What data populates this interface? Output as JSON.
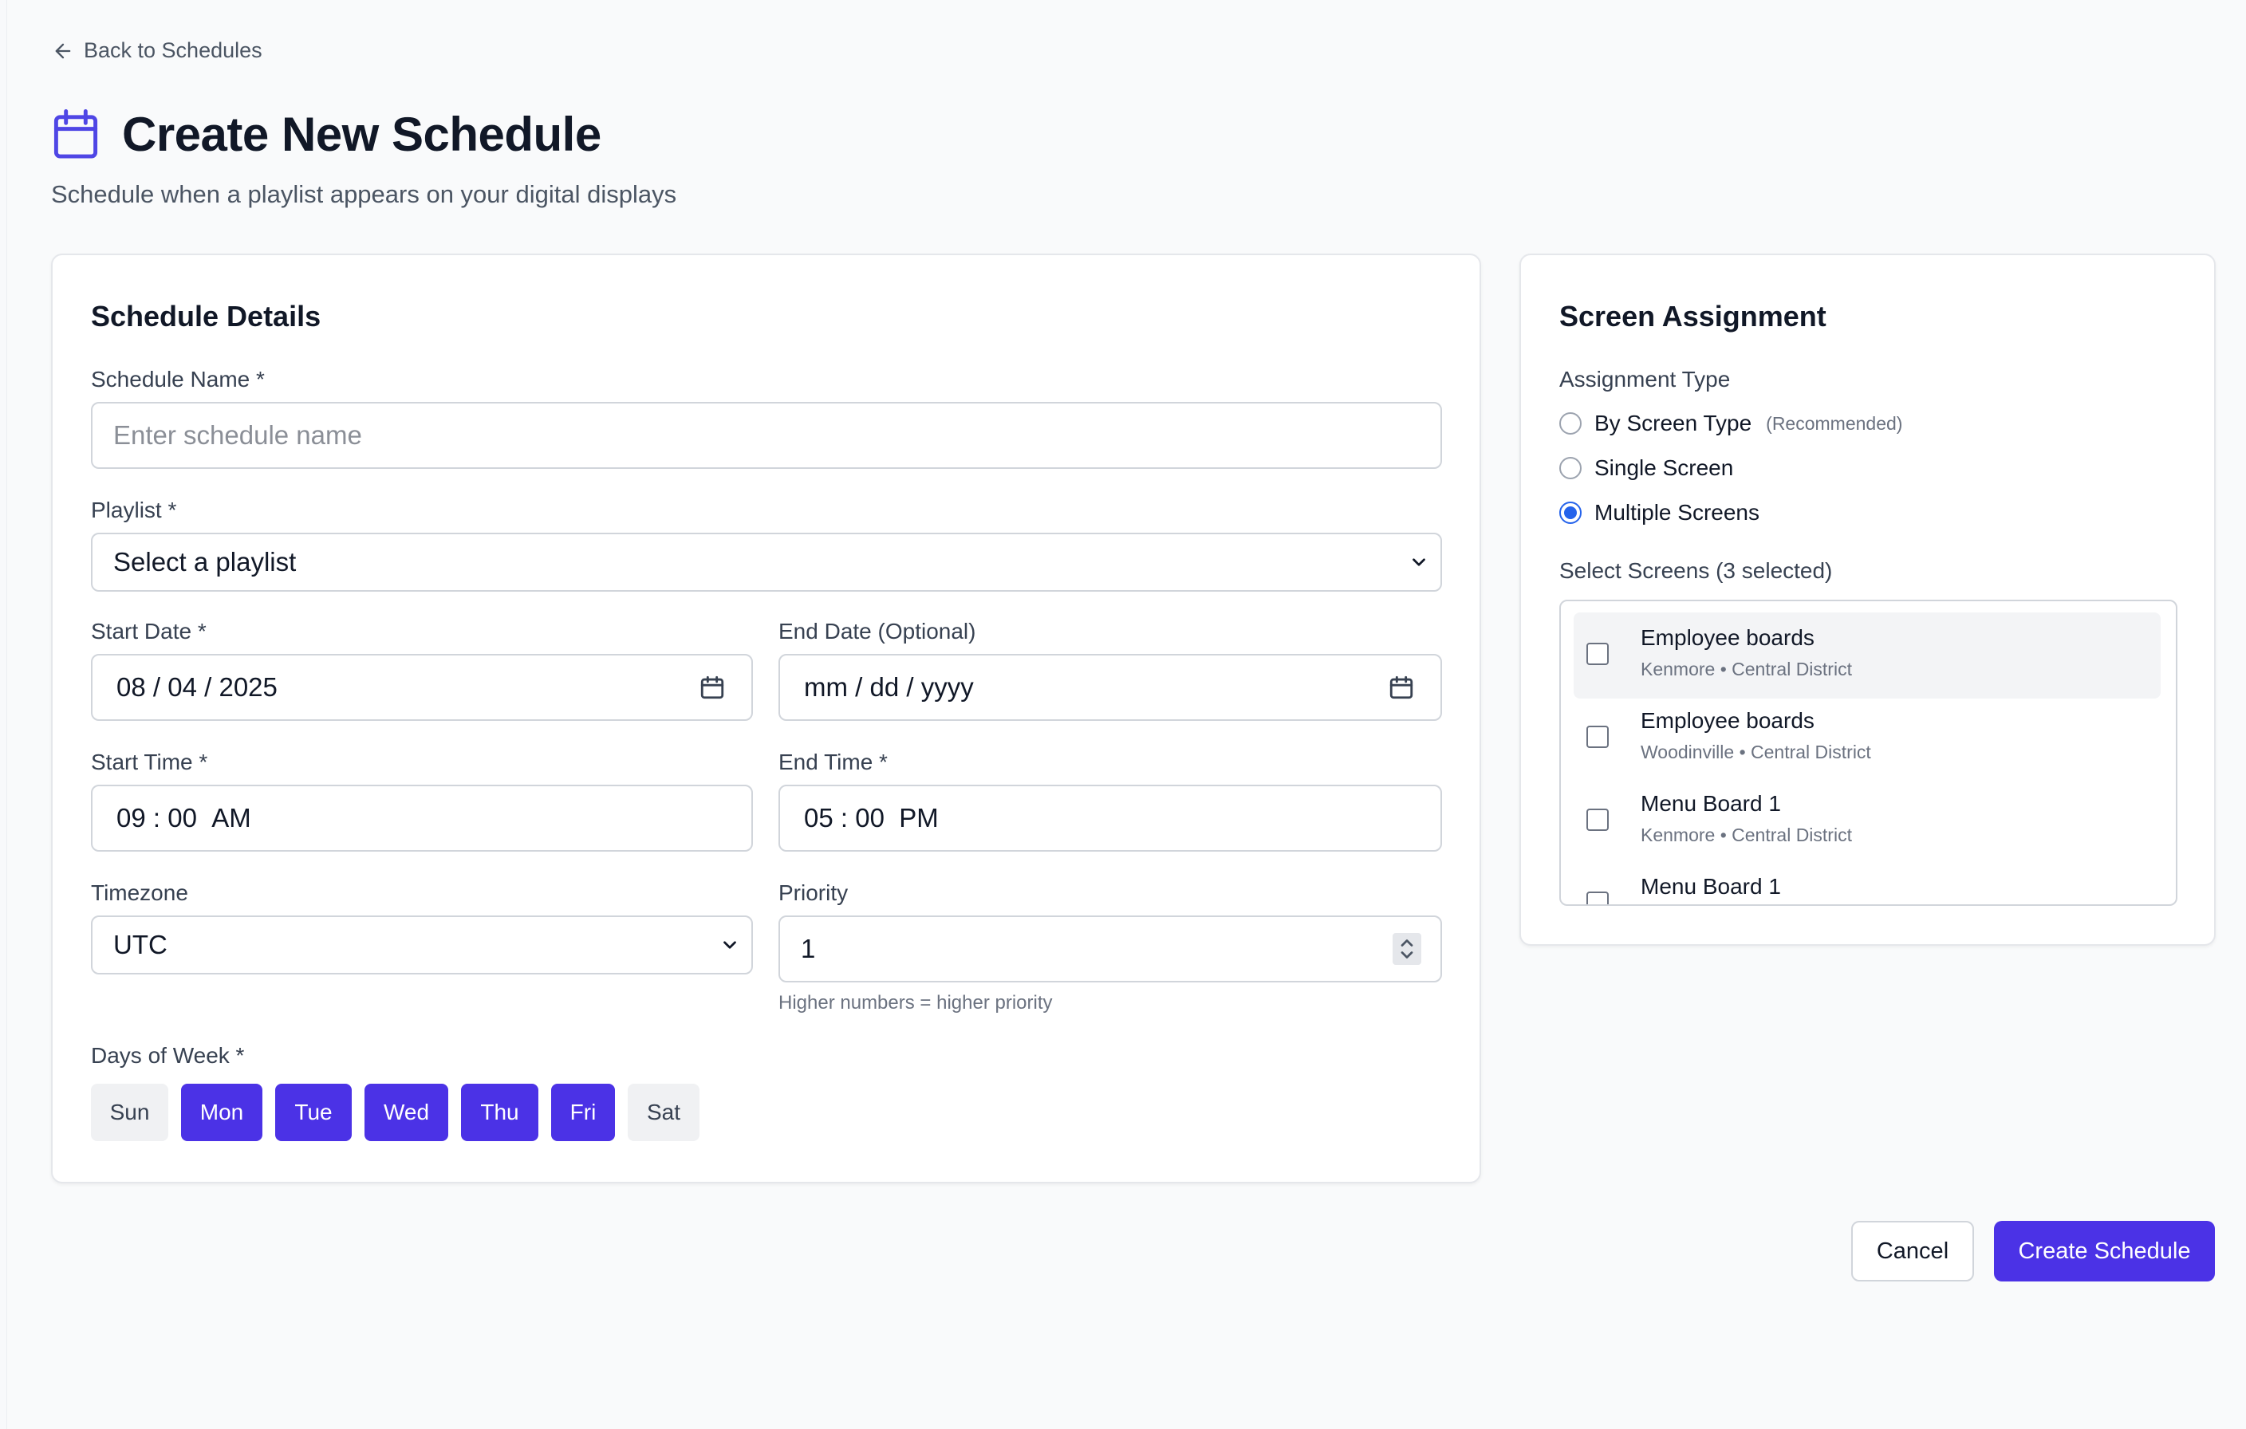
{
  "nav": {
    "back_label": "Back to Schedules"
  },
  "header": {
    "title": "Create New Schedule",
    "subtitle": "Schedule when a playlist appears on your digital displays",
    "icon": "calendar-icon",
    "accent_color": "#4f46e5"
  },
  "details": {
    "title": "Schedule Details",
    "schedule_name": {
      "label": "Schedule Name *",
      "placeholder": "Enter schedule name",
      "value": ""
    },
    "playlist": {
      "label": "Playlist *",
      "selected": "Select a playlist"
    },
    "start_date": {
      "label": "Start Date *",
      "month": "08",
      "day": "04",
      "year": "2025"
    },
    "end_date": {
      "label": "End Date (Optional)",
      "month": "mm",
      "day": "dd",
      "year": "yyyy"
    },
    "start_time": {
      "label": "Start Time *",
      "hour": "09",
      "minute": "00",
      "period": "AM"
    },
    "end_time": {
      "label": "End Time *",
      "hour": "05",
      "minute": "00",
      "period": "PM"
    },
    "timezone": {
      "label": "Timezone",
      "selected": "UTC"
    },
    "priority": {
      "label": "Priority",
      "value": "1",
      "hint": "Higher numbers = higher priority"
    },
    "days_label": "Days of Week *",
    "days": [
      {
        "label": "Sun",
        "selected": false
      },
      {
        "label": "Mon",
        "selected": true
      },
      {
        "label": "Tue",
        "selected": true
      },
      {
        "label": "Wed",
        "selected": true
      },
      {
        "label": "Thu",
        "selected": true
      },
      {
        "label": "Fri",
        "selected": true
      },
      {
        "label": "Sat",
        "selected": false
      }
    ]
  },
  "screens": {
    "title": "Screen Assignment",
    "assignment_label": "Assignment Type",
    "options": [
      {
        "label": "By Screen Type",
        "note": "(Recommended)",
        "checked": false
      },
      {
        "label": "Single Screen",
        "note": "",
        "checked": false
      },
      {
        "label": "Multiple Screens",
        "note": "",
        "checked": true
      }
    ],
    "select_label": "Select Screens (3 selected)",
    "items": [
      {
        "name": "Employee boards",
        "location": "Kenmore • Central District",
        "checked": false
      },
      {
        "name": "Employee boards",
        "location": "Woodinville • Central District",
        "checked": false
      },
      {
        "name": "Menu Board 1",
        "location": "Kenmore • Central District",
        "checked": false
      },
      {
        "name": "Menu Board 1",
        "location": "",
        "checked": false
      }
    ]
  },
  "actions": {
    "cancel_label": "Cancel",
    "create_label": "Create Schedule"
  }
}
